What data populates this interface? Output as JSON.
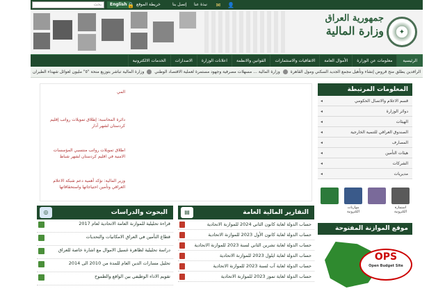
{
  "topbar": {
    "search_placeholder": "بحث",
    "english_label": "English",
    "sitemap_label": "خريطة الموقع",
    "contact_label": "إتصل بنا",
    "about_label": "نبذة عنا"
  },
  "header": {
    "logo_line1": "جمهورية العراق",
    "logo_line2": "وزارة المالية"
  },
  "nav": {
    "items": [
      {
        "label": "الرئيسية"
      },
      {
        "label": "معلومات عن الوزارة"
      },
      {
        "label": "الأموال العامة"
      },
      {
        "label": "الاتفاقيات والاستثمارات"
      },
      {
        "label": "القوانين والانظمة"
      },
      {
        "label": "اعلانات الوزارة"
      },
      {
        "label": "الاصدارات"
      },
      {
        "label": "الخدمات الالكترونية"
      }
    ]
  },
  "ticker": {
    "text1": "وزارة المالية تباشر بتوزيع منحة \"٥\" مليون لعوائل شهداء الطيران",
    "text2": "وزارة المالية ... مسهلات مصرفية وجهود مستمرة لعملية الاقتصاد الوطني",
    "text3": "الرافدين يطلق منح قروض إنشاء وتأهيل مجمع الجديد السكني ومول القاهرة"
  },
  "sidebar": {
    "title": "المعلومات المرتبطة",
    "items": [
      {
        "label": "قسم الاعلام والاتصال الحكومي"
      },
      {
        "label": "دوائر الوزارة"
      },
      {
        "label": "الهيئات"
      },
      {
        "label": "الصندوق العراقي للتنمية الخارجية"
      },
      {
        "label": "المصارف"
      },
      {
        "label": "هيئات التأمين"
      },
      {
        "label": "الشركات"
      },
      {
        "label": "مديريات"
      }
    ]
  },
  "icons_row": {
    "items": [
      {
        "label": "استمارة الكترونية",
        "color": "#5a5a5a"
      },
      {
        "label": "",
        "color": "#7a6a9a"
      },
      {
        "label": "موازنات الكترونية",
        "color": "#3a5a8a"
      },
      {
        "label": "",
        "color": "#2c7a3a"
      }
    ]
  },
  "budget": {
    "title": "موقع الموازنة المفتوحة",
    "ops_label": "OPS",
    "ops_sub": "Open Budget Site"
  },
  "news": {
    "items": [
      {
        "text": "المي"
      },
      {
        "text": "دائرة المحاسبة: إطلاق تمويلات رواتب إقليم كردستان لشهر آذار"
      },
      {
        "text": "اطلاق تمويلات رواتب منتسبي المؤسسات الامنية في اقليم كردستان لشهر شباط"
      },
      {
        "text": "وزير المالية: نؤكد أهمية دعم شبكة الاعلام العراقي وتأمين احتياجاتها واستحقاقاتها"
      }
    ]
  },
  "reports": {
    "title": "التقارير المالية العامة",
    "items": [
      {
        "label": "حساب الدولة لغاية كانون الثاني 2024 للموازنة الاتحادية"
      },
      {
        "label": "حساب الدولة لغاية كانون الأول 2023 للموازنة الاتحادية"
      },
      {
        "label": "حساب الدولة لغاية تشرين الثاني لسنة 2023 للموازنة الاتحادية"
      },
      {
        "label": "حساب الدولة لغاية ايلول 2023 للموازنة الاتحادية"
      },
      {
        "label": "حساب الدولة لغاية آب لسنة 2023 للموازنة الاتحادية"
      },
      {
        "label": "حساب الدولة لغاية تموز 2023 للموازنة الاتحادية"
      }
    ]
  },
  "research": {
    "title": "البحوث والدراسات",
    "items": [
      {
        "label": "قراءة تحليلية للموازنة العامة الاتحادية لعام 2017"
      },
      {
        "label": "قطاع التأمين في العراق الامكانيات والتحديات"
      },
      {
        "label": "دراسة تحليلية لظاهرة غسيل الاموال مع اشارة خاصة للعراق"
      },
      {
        "label": "تحليل مسارات الدين العام للمدة من 2010 الى 2014"
      },
      {
        "label": "تقويم الاداء الوظيفي بين الواقع والطموح"
      }
    ]
  }
}
